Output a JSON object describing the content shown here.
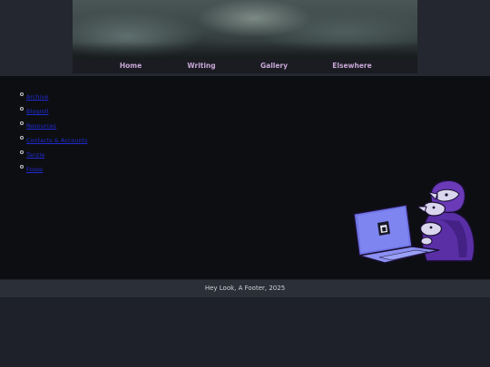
{
  "nav": {
    "items": [
      "Home",
      "Writing",
      "Gallery",
      "Elsewhere"
    ]
  },
  "links": [
    "Archive",
    "Blogroll",
    "Resources",
    "Contacts & Accounts",
    "Tanzie",
    "Foxes"
  ],
  "footer": {
    "text": "Hey Look, A Footer, 2025"
  },
  "colors": {
    "background": "#1e2129",
    "main_panel": "#0d0e12",
    "nav_text": "#c9a6d6",
    "link": "#1f2bcf",
    "mascot_purple": "#6a3ab8",
    "laptop_blue": "#6f74e6"
  }
}
